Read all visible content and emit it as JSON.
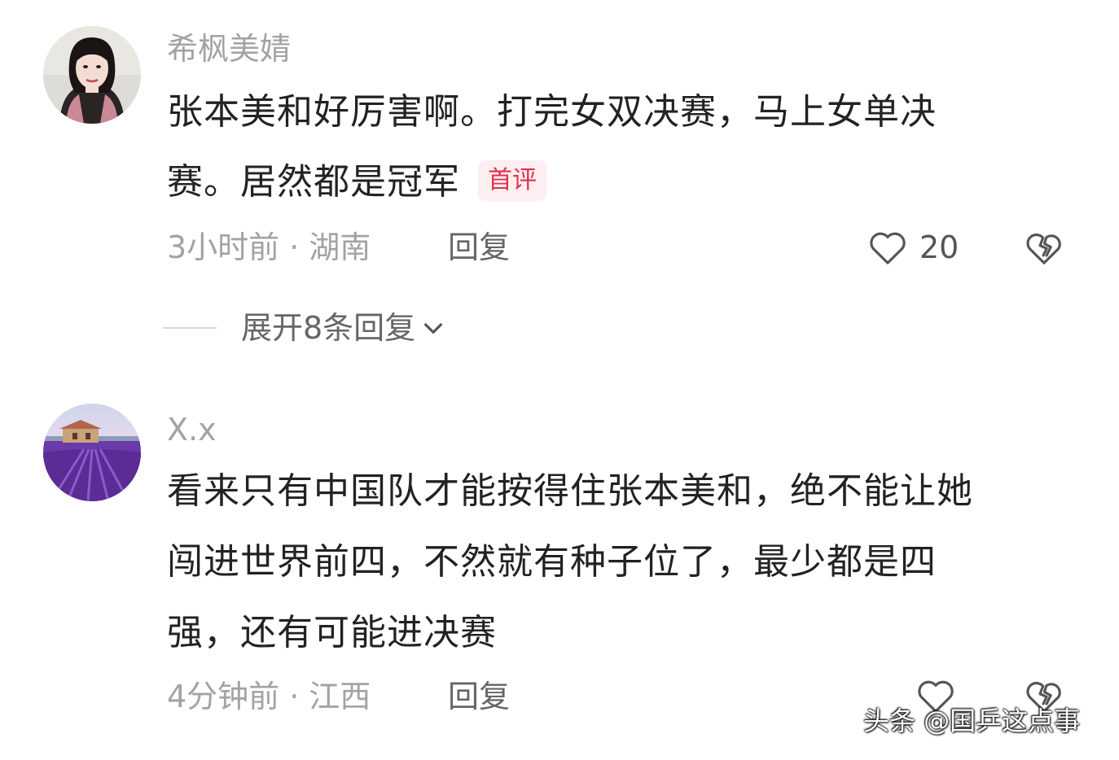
{
  "comments": [
    {
      "avatar_icon": "user-portrait-woman",
      "username": "希枫美婧",
      "text_lines": [
        "张本美和好厉害啊。打完女双决赛，马上女单决",
        "赛。居然都是冠军"
      ],
      "badge": "首评",
      "time": "3小时前",
      "separator": "·",
      "location": "湖南",
      "reply_label": "回复",
      "like_count": "20",
      "like_icon": "heart-outline-icon",
      "dislike_icon": "broken-heart-icon"
    },
    {
      "avatar_icon": "lavender-field-house-picture",
      "username": "X.x",
      "text_lines": [
        "看来只有中国队才能按得住张本美和，绝不能让她",
        "闯进世界前四，不然就有种子位了，最少都是四",
        "强，还有可能进决赛"
      ],
      "time": "4分钟前",
      "separator": "·",
      "location": "江西",
      "reply_label": "回复",
      "like_icon": "heart-outline-icon",
      "dislike_icon": "broken-heart-icon"
    }
  ],
  "expand_replies": {
    "label": "展开8条回复",
    "icon": "chevron-down-icon"
  },
  "watermark": "头条 @国乒这点事",
  "colors": {
    "text": "#222222",
    "muted": "#a3a3a3",
    "badge_text": "#e0304e",
    "badge_bg": "#fdeef0"
  }
}
